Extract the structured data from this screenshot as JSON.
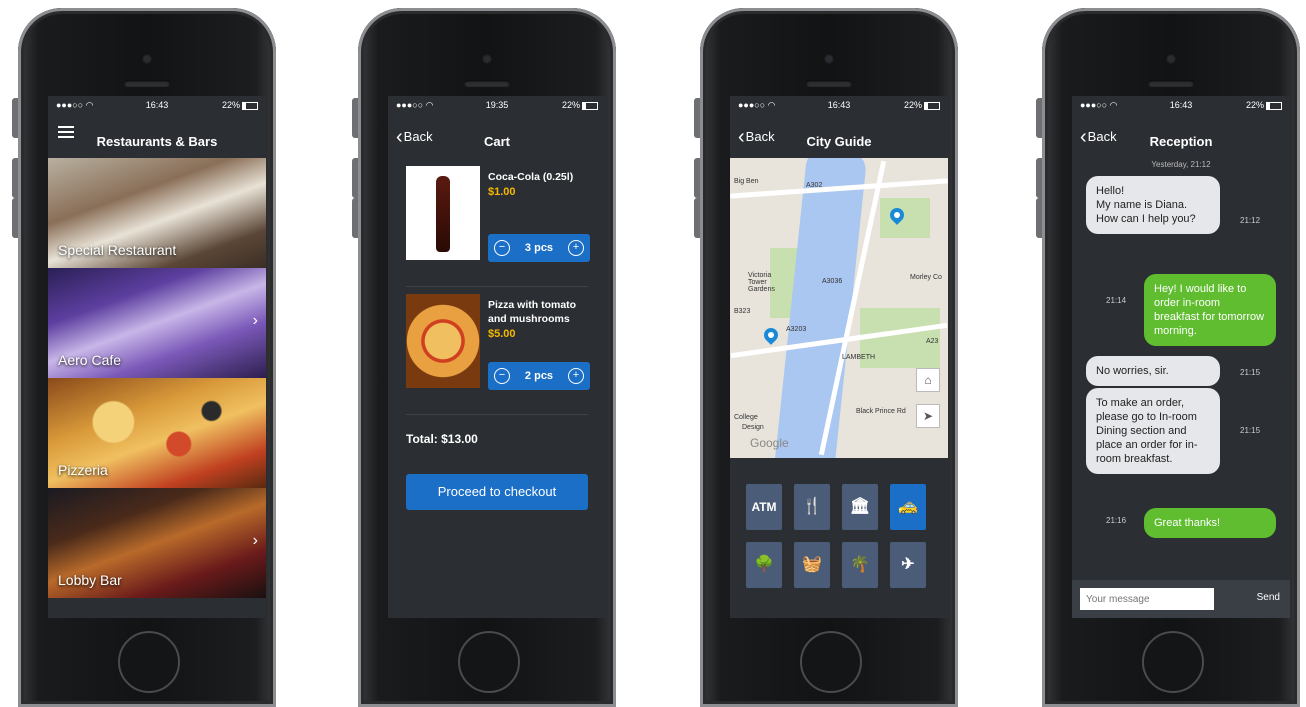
{
  "screens": {
    "restaurants": {
      "status": {
        "time": "16:43",
        "battery": "22%"
      },
      "title": "Restaurants & Bars",
      "items": [
        {
          "label": "Special Restaurant"
        },
        {
          "label": "Aero Cafe"
        },
        {
          "label": "Pizzeria"
        },
        {
          "label": "Lobby Bar"
        }
      ]
    },
    "cart": {
      "status": {
        "time": "19:35",
        "battery": "22%"
      },
      "back": "Back",
      "title": "Cart",
      "items": [
        {
          "name": "Coca-Cola (0.25l)",
          "price": "$1.00",
          "qty": "3 pcs"
        },
        {
          "name": "Pizza with tomato and mushrooms",
          "price": "$5.00",
          "qty": "2 pcs"
        }
      ],
      "total": "Total: $13.00",
      "checkout": "Proceed to checkout"
    },
    "city_guide": {
      "status": {
        "time": "16:43",
        "battery": "22%"
      },
      "back": "Back",
      "title": "City Guide",
      "map_labels": [
        "Big Ben",
        "A302",
        "Victoria Tower Gardens",
        "B323",
        "A3203",
        "A3036",
        "Morley Co",
        "LAMBETH",
        "Black Prince Rd",
        "Design",
        "College",
        "A23"
      ],
      "map_attribution": "Google",
      "categories": [
        {
          "label": "ATM",
          "icon": "atm-icon"
        },
        {
          "label": "",
          "icon": "restaurant-icon"
        },
        {
          "label": "",
          "icon": "museum-icon"
        },
        {
          "label": "",
          "icon": "taxi-icon"
        },
        {
          "label": "",
          "icon": "park-icon"
        },
        {
          "label": "",
          "icon": "shopping-icon"
        },
        {
          "label": "",
          "icon": "beach-icon"
        },
        {
          "label": "",
          "icon": "airport-icon"
        }
      ]
    },
    "reception": {
      "status": {
        "time": "16:43",
        "battery": "22%"
      },
      "back": "Back",
      "title": "Reception",
      "date": "Yesterday, 21:12",
      "messages": [
        {
          "dir": "in",
          "text": "Hello!\nMy name is Diana.\nHow can I help you?",
          "time": "21:12"
        },
        {
          "dir": "out",
          "text": "Hey! I would like to order in-room breakfast for tomorrow morning.",
          "time": "21:14"
        },
        {
          "dir": "in",
          "text": "No worries, sir.",
          "time": "21:15"
        },
        {
          "dir": "in",
          "text": "To make an order, please go to In-room Dining section and place an order for in-room breakfast.",
          "time": "21:15"
        },
        {
          "dir": "out",
          "text": "Great thanks!",
          "time": "21:16"
        }
      ],
      "input_placeholder": "Your message",
      "send": "Send"
    }
  }
}
